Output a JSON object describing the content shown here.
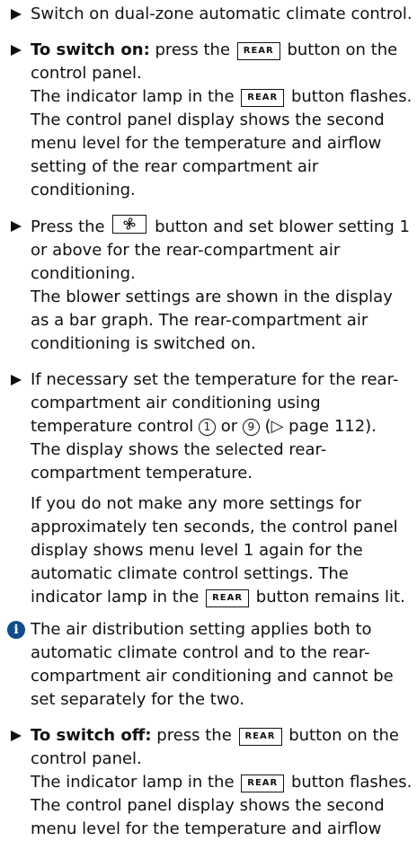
{
  "items": [
    {
      "text": "Switch on dual-zone automatic climate control."
    },
    {
      "bold": "To switch on:",
      "pre": " press the ",
      "key": "REAR",
      "post": " button on the control panel.",
      "line2_pre": "The indicator lamp in the ",
      "line2_key": "REAR",
      "line2_post": " button flashes. The control panel display shows the second menu level for the temperature and airflow setting of the rear compartment air conditioning."
    },
    {
      "pre": "Press the ",
      "icon": "fan-icon",
      "post": " button and set blower setting 1 or above for the rear-compartment air conditioning.",
      "line2": "The blower settings are shown in the display as a bar graph. The rear-compartment air conditioning is switched on."
    },
    {
      "pre": "If necessary set the temperature for the rear-compartment air conditioning using temperature control ",
      "c1": "1",
      "mid": " or ",
      "c2": "9",
      "post": " (▷ page 112).",
      "line2": "The display shows the selected rear-compartment temperature.",
      "para_pre": "If you do not make any more settings for approximately ten seconds, the control panel display shows menu level 1 again for the automatic climate control settings. The indicator lamp in the ",
      "para_key": "REAR",
      "para_post": " button remains lit."
    }
  ],
  "note": {
    "icon": "info-icon",
    "glyph": "i",
    "text": "The air distribution setting applies both to automatic climate control and to the rear-compartment air conditioning and cannot be set separately for the two."
  },
  "last": {
    "bold": "To switch off:",
    "pre": " press the ",
    "key": "REAR",
    "post": " button on the control panel.",
    "line2_pre": "The indicator lamp in the ",
    "line2_key": "REAR",
    "line2_post": " button flashes. The control panel display shows the second menu level for the temperature and airflow"
  }
}
